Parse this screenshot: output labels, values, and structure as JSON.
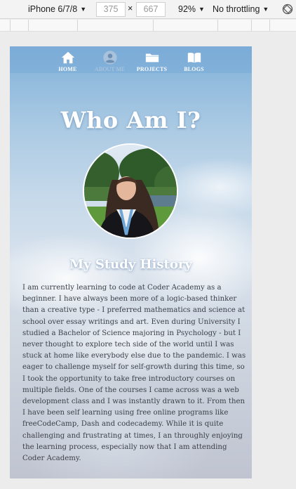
{
  "devtools": {
    "device": "iPhone 6/7/8",
    "width": "375",
    "times": "×",
    "height": "667",
    "zoom": "92%",
    "throttle": "No throttling"
  },
  "nav": {
    "items": [
      {
        "label": "HOME",
        "icon": "home-icon"
      },
      {
        "label": "ABOUT ME",
        "icon": "user-icon"
      },
      {
        "label": "PROJECTS",
        "icon": "folder-icon"
      },
      {
        "label": "BLOGS",
        "icon": "book-icon"
      }
    ]
  },
  "page": {
    "title": "Who Am I?",
    "section_title": "My Study History",
    "body": "I am currently learning to code at Coder Academy as a beginner. I have always been more of a logic-based thinker than a creative type - I preferred mathematics and science at school over essay writings and art. Even during University I studied a Bachelor of Science majoring in Psychology - but I never thought to explore tech side of the world until I was stuck at home like everybody else due to the pandemic. I was eager to challenge myself for self-growth during this time, so I took the opportunity to take free introductory courses on multiple fields. One of the courses I came across was a web development class and I was instantly drawn to it. From then I have been self learning using free online programs like freeCodeCamp, Dash and codecademy. While it is quite challenging and frustrating at times, I an throughly enjoying the learning process, especially now that I am attending Coder Academy."
  },
  "colors": {
    "nav_bg": "#78aad7",
    "title": "#ffffff",
    "text": "#3b3f48"
  }
}
